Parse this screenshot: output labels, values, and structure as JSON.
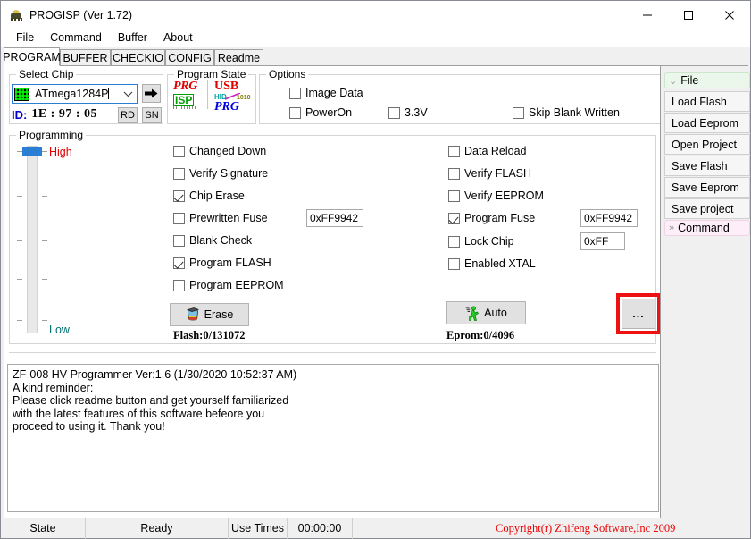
{
  "window": {
    "title": "PROGISP (Ver 1.72)",
    "icon": "bug-icon",
    "minimize": "—",
    "maximize": "□",
    "close": "✕"
  },
  "menu": {
    "items": [
      "File",
      "Command",
      "Buffer",
      "About"
    ]
  },
  "tabs": {
    "items": [
      "PROGRAM",
      "BUFFER",
      "CHECKIO",
      "CONFIG",
      "Readme"
    ],
    "active": "PROGRAM"
  },
  "select_chip": {
    "legend": "Select Chip",
    "combo_value": "ATmega1284P",
    "combo_icon": "chip-icon",
    "go_button_icon": "arrow-right-icon",
    "id_label": "ID:",
    "id_value": "1E : 97 : 05",
    "rd_button": "RD",
    "sn_button": "SN"
  },
  "program_state": {
    "legend": "Program State",
    "logo_isp": {
      "top": "PRG",
      "bottom": "ISP"
    },
    "logo_usb": {
      "top": "USB",
      "mid_left": "HID",
      "mid_right": "1010",
      "bottom": "PRG"
    }
  },
  "options": {
    "legend": "Options",
    "items": [
      {
        "label": "Image Data",
        "checked": false
      },
      {
        "label": "PowerOn",
        "checked": false
      },
      {
        "label": "3.3V",
        "checked": false
      },
      {
        "label": "Skip Blank Written",
        "checked": false
      }
    ]
  },
  "programming": {
    "legend": "Programming",
    "slider": {
      "high_label": "High",
      "low_label": "Low",
      "value_position": "high"
    },
    "left_checks": [
      {
        "label": "Changed Down",
        "checked": false
      },
      {
        "label": "Verify Signature",
        "checked": false
      },
      {
        "label": "Chip Erase",
        "checked": true
      },
      {
        "label": "Prewritten Fuse",
        "checked": false
      },
      {
        "label": "Blank Check",
        "checked": false
      },
      {
        "label": "Program FLASH",
        "checked": true
      },
      {
        "label": "Program EEPROM",
        "checked": false
      }
    ],
    "right_checks": [
      {
        "label": "Data Reload",
        "checked": false
      },
      {
        "label": "Verify FLASH",
        "checked": false
      },
      {
        "label": "Verify EEPROM",
        "checked": false
      },
      {
        "label": "Program Fuse",
        "checked": true
      },
      {
        "label": "Lock Chip",
        "checked": false
      },
      {
        "label": "Enabled XTAL",
        "checked": false
      }
    ],
    "prewritten_fuse_value": "0xFF9942",
    "program_fuse_value": "0xFF9942",
    "lock_chip_value": "0xFF",
    "erase_button": {
      "label": "Erase",
      "icon": "trash-icon"
    },
    "auto_button": {
      "label": "Auto",
      "icon": "running-man-icon"
    },
    "more_button": {
      "label": "...",
      "icon": "ellipsis-icon",
      "highlighted": true
    },
    "flash_stat": "Flash:0/131072",
    "eprom_stat": "Eprom:0/4096"
  },
  "log": {
    "lines": [
      "ZF-008 HV Programmer Ver:1.6 (1/30/2020 10:52:37 AM)",
      "A kind reminder:",
      "Please click readme button and get yourself familiarized",
      "with the latest features of this software befeore you",
      "proceed to using it. Thank you!"
    ]
  },
  "sidebar": {
    "file_group": {
      "label": "File",
      "chevron": "»"
    },
    "buttons": [
      "Load Flash",
      "Load Eeprom",
      "Open Project",
      "Save Flash",
      "Save Eeprom",
      "Save project"
    ],
    "command_group": {
      "label": "Command",
      "chevron": "»"
    }
  },
  "statusbar": {
    "state_label": "State",
    "state_value": "Ready",
    "use_times_label": "Use Times",
    "use_times_value": "00:00:00",
    "copyright": "Copyright(r) Zhifeng Software,Inc 2009"
  },
  "colors": {
    "accent": "#2a7fd4",
    "highlight": "#ee1111",
    "copyright": "#ee0000",
    "high": "#e00000",
    "low": "#007070",
    "id": "#0000cc"
  }
}
